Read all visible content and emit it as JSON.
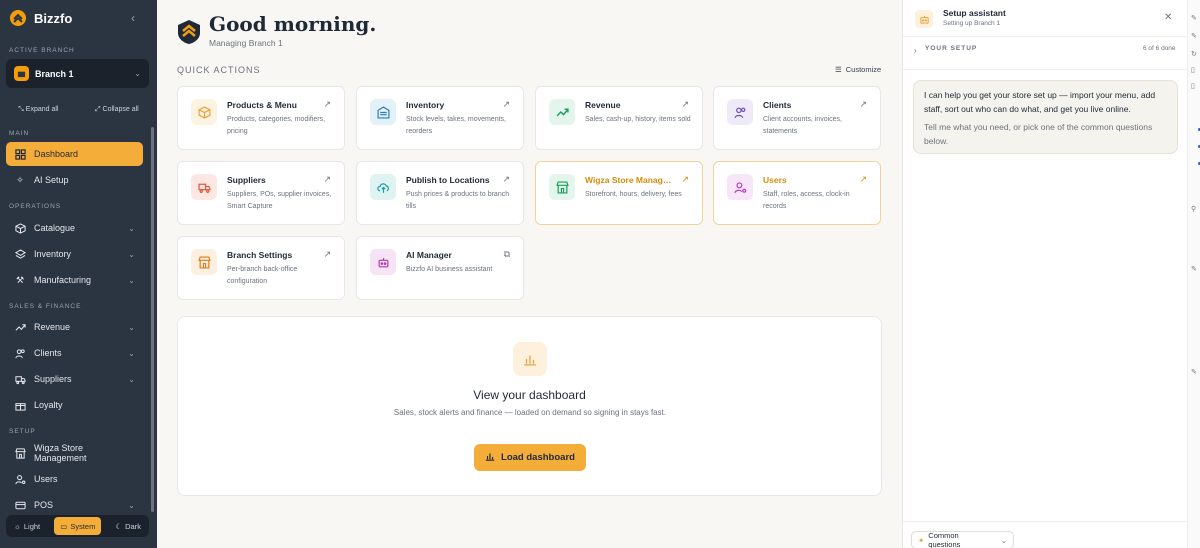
{
  "sidebar": {
    "brand": "Bizzfo",
    "active_branch_label": "ACTIVE BRANCH",
    "branch": "Branch 1",
    "expand_all": "Expand all",
    "collapse_all": "Collapse all",
    "sections": {
      "main": "MAIN",
      "operations": "OPERATIONS",
      "sales": "SALES & FINANCE",
      "setup": "SETUP"
    },
    "items": [
      {
        "label": "Dashboard",
        "icon": "grid-icon"
      },
      {
        "label": "AI Setup",
        "icon": "sparkle-icon"
      },
      {
        "label": "Catalogue",
        "icon": "box-icon"
      },
      {
        "label": "Inventory",
        "icon": "layers-icon"
      },
      {
        "label": "Manufacturing",
        "icon": "tool-icon"
      },
      {
        "label": "Revenue",
        "icon": "trend-icon"
      },
      {
        "label": "Clients",
        "icon": "people-icon"
      },
      {
        "label": "Suppliers",
        "icon": "truck-icon"
      },
      {
        "label": "Loyalty",
        "icon": "gift-icon"
      },
      {
        "label": "Wigza Store Management",
        "icon": "store-icon"
      },
      {
        "label": "Users",
        "icon": "user-gear-icon"
      },
      {
        "label": "POS",
        "icon": "card-icon"
      }
    ],
    "theme": {
      "light": "Light",
      "system": "System",
      "dark": "Dark"
    }
  },
  "main": {
    "greeting": "Good morning.",
    "subtitle": "Managing Branch 1",
    "quick_actions_label": "QUICK ACTIONS",
    "customize": "Customize",
    "cards": [
      {
        "title": "Products & Menu",
        "desc": "Products, categories, modifiers, pricing",
        "icon": "box-icon"
      },
      {
        "title": "Inventory",
        "desc": "Stock levels, takes, movements, reorders",
        "icon": "inventory-icon"
      },
      {
        "title": "Revenue",
        "desc": "Sales, cash-up, history, items sold",
        "icon": "trend-icon"
      },
      {
        "title": "Clients",
        "desc": "Client accounts, invoices, statements",
        "icon": "people-icon"
      },
      {
        "title": "Suppliers",
        "desc": "Suppliers, POs, supplier invoices, Smart Capture",
        "icon": "truck-icon"
      },
      {
        "title": "Publish to Locations",
        "desc": "Push prices & products to branch tills",
        "icon": "cloud-upload-icon"
      },
      {
        "title": "Wigza Store Management",
        "desc": "Storefront, hours, delivery, fees",
        "icon": "store-icon"
      },
      {
        "title": "Users",
        "desc": "Staff, roles, access, clock-in records",
        "icon": "user-gear-icon"
      },
      {
        "title": "Branch Settings",
        "desc": "Per-branch back-office configuration",
        "icon": "store-icon"
      },
      {
        "title": "AI Manager",
        "desc": "Bizzfo AI business assistant",
        "icon": "robot-icon"
      }
    ],
    "dashboard": {
      "title": "View your dashboard",
      "desc": "Sales, stock alerts and finance — loaded on demand so signing in stays fast.",
      "button": "Load dashboard"
    }
  },
  "assistant": {
    "title": "Setup assistant",
    "subtitle": "Setting up Branch 1",
    "your_setup": "YOUR SETUP",
    "progress": "6 of 6 done",
    "message": "I can help you get your store set up — import your menu, add staff, sort out who can do what, and get you live online.",
    "message_hint": "Tell me what you need, or pick one of the common questions below.",
    "common_questions": "Common questions"
  }
}
